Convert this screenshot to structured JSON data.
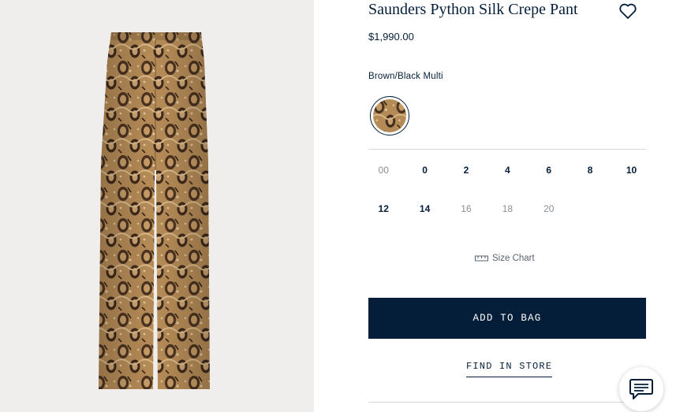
{
  "product": {
    "title": "Saunders Python Silk Crepe Pant",
    "price": "$1,990.00",
    "color_name": "Brown/Black Multi"
  },
  "sizes": [
    {
      "label": "00",
      "available": false
    },
    {
      "label": "0",
      "available": true
    },
    {
      "label": "2",
      "available": true
    },
    {
      "label": "4",
      "available": true
    },
    {
      "label": "6",
      "available": true
    },
    {
      "label": "8",
      "available": true
    },
    {
      "label": "10",
      "available": true
    },
    {
      "label": "12",
      "available": true
    },
    {
      "label": "14",
      "available": true
    },
    {
      "label": "16",
      "available": false
    },
    {
      "label": "18",
      "available": false
    },
    {
      "label": "20",
      "available": false
    }
  ],
  "size_chart_label": "Size Chart",
  "add_to_bag_label": "ADD TO BAG",
  "find_in_store_label": "FIND IN STORE",
  "icons": {
    "wishlist": "heart-icon",
    "size_chart": "ruler-icon",
    "chat": "chat-icon"
  },
  "colors": {
    "brand_navy": "#041e3a",
    "image_background": "#efeeec",
    "python_base": "#b48a56"
  }
}
